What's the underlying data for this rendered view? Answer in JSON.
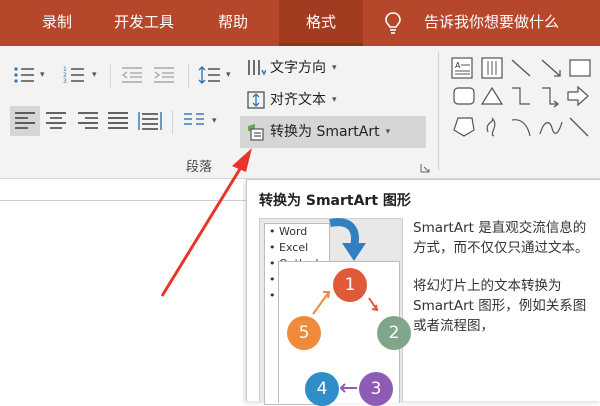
{
  "tabs": [
    {
      "label": "录制",
      "active": false
    },
    {
      "label": "开发工具",
      "active": false
    },
    {
      "label": "帮助",
      "active": false
    },
    {
      "label": "格式",
      "active": true
    }
  ],
  "tell_me": {
    "label": "告诉我你想要做什么",
    "icon": "lightbulb-icon"
  },
  "paragraph": {
    "text_direction_label": "文字方向",
    "align_text_label": "对齐文本",
    "convert_smartart_label": "转换为 SmartArt",
    "group_label": "段落"
  },
  "tooltip": {
    "title": "转换为 SmartArt 图形",
    "desc1": "SmartArt 是直观交流信息的方式，而不仅仅只通过文本。",
    "desc2": "将幻灯片上的文本转换为 SmartArt 图形，例如关系图或者流程图，",
    "preview_bullets": [
      "Word",
      "Excel",
      "Outlook",
      "",
      ""
    ],
    "preview_cycle": [
      "1",
      "2",
      "3",
      "4",
      "5"
    ]
  },
  "colors": {
    "tabbar": "#b7472a",
    "arrow": "#e8352a",
    "highlight": "#d6d6d6",
    "c1": "#e05a3a",
    "c2": "#7fa58a",
    "c3": "#8e5cb5",
    "c4": "#2f8ec9",
    "c5": "#ee8a3a"
  }
}
